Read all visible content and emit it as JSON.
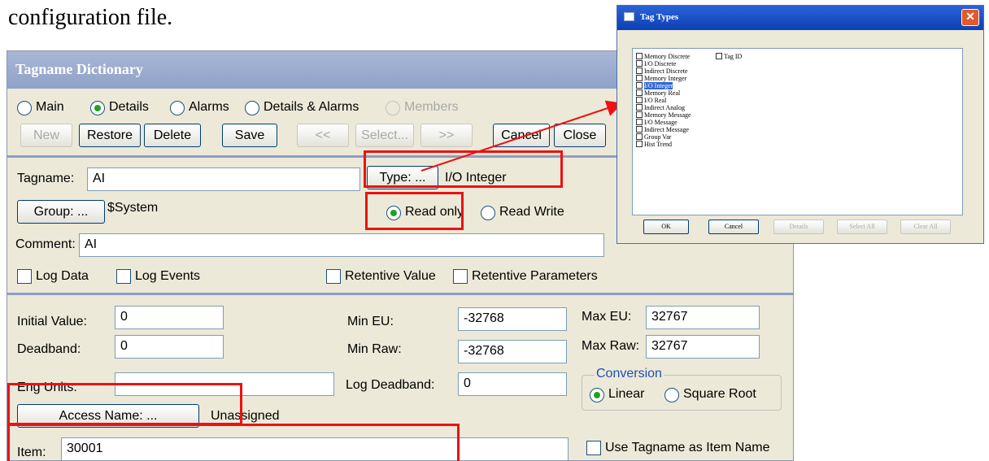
{
  "doc_text": "configuration file.",
  "dialog": {
    "title": "Tagname Dictionary",
    "view_options": [
      "Main",
      "Details",
      "Alarms",
      "Details & Alarms",
      "Members"
    ],
    "selected_view": "Details",
    "toolbar": {
      "new": "New",
      "restore": "Restore",
      "delete": "Delete",
      "save": "Save",
      "prev": "<<",
      "select": "Select...",
      "next": ">>",
      "cancel": "Cancel",
      "close": "Close"
    },
    "tagname_label": "Tagname:",
    "tagname_value": "AI",
    "type_button": "Type: ...",
    "type_value": "I/O Integer",
    "group_button": "Group: ...",
    "group_value": "$System",
    "access": {
      "read_only": "Read only",
      "read_write": "Read Write",
      "selected": "Read only"
    },
    "comment_label": "Comment:",
    "comment_value": "AI",
    "checks": {
      "log_data": "Log Data",
      "log_events": "Log Events",
      "retentive_value": "Retentive Value",
      "retentive_parameters": "Retentive Parameters"
    },
    "details": {
      "initial_value_label": "Initial Value:",
      "initial_value": "0",
      "deadband_label": "Deadband:",
      "deadband": "0",
      "eng_units_label": "Eng Units:",
      "eng_units": "",
      "min_eu_label": "Min EU:",
      "min_eu": "-32768",
      "min_raw_label": "Min Raw:",
      "min_raw": "-32768",
      "log_deadband_label": "Log Deadband:",
      "log_deadband": "0",
      "max_eu_label": "Max EU:",
      "max_eu": "32767",
      "max_raw_label": "Max Raw:",
      "max_raw": "32767",
      "conversion_label": "Conversion",
      "linear": "Linear",
      "square_root": "Square Root",
      "access_name_button": "Access Name: ...",
      "access_name_value": "Unassigned",
      "item_label": "Item:",
      "item_value": "30001",
      "use_tagname_label": "Use Tagname as Item Name"
    }
  },
  "tag_types": {
    "title": "Tag Types",
    "items": [
      "Memory Discrete",
      "I/O Discrete",
      "Indirect Discrete",
      "Memory Integer",
      "I/O Integer",
      "Memory Real",
      "I/O Real",
      "Indirect Analog",
      "Memory Message",
      "I/O Message",
      "Indirect Message",
      "Group Var",
      "Hist Trend"
    ],
    "extra_item": "Tag ID",
    "selected_item": "I/O Integer",
    "buttons": {
      "ok": "OK",
      "cancel": "Cancel",
      "details": "Details",
      "select_all": "Select All",
      "clear_all": "Clear All"
    }
  },
  "colors": {
    "highlight": "#ee1111",
    "title_bar": "#8ea2c9",
    "dialog_bg": "#ece9d8"
  }
}
